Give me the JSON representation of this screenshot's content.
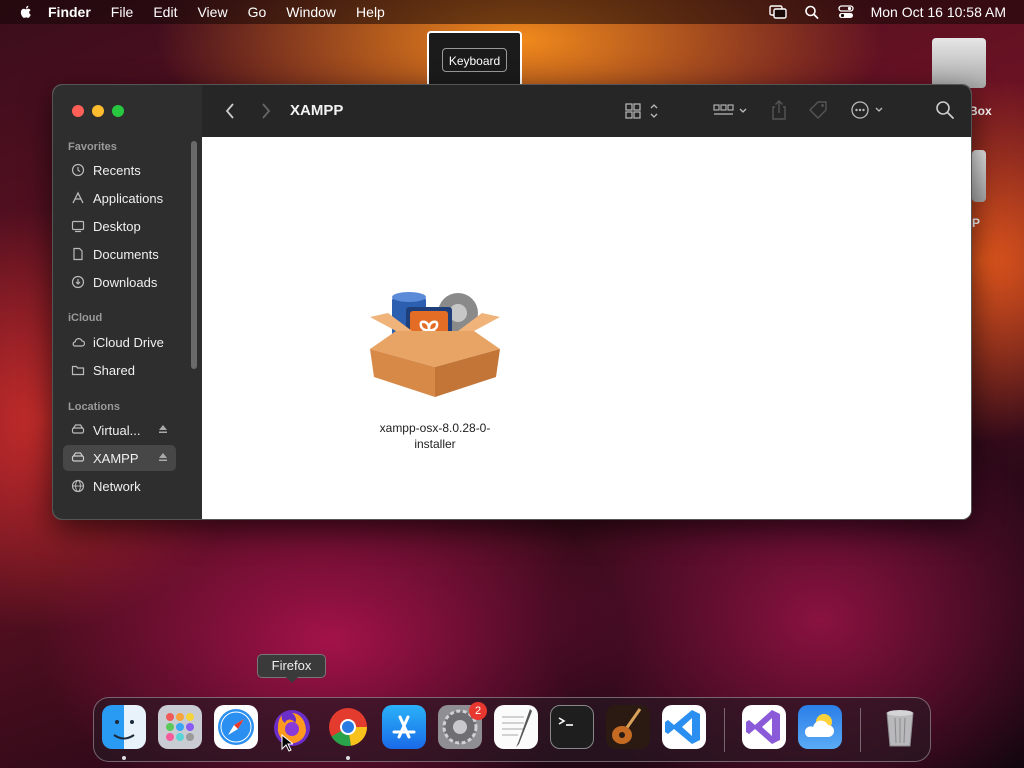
{
  "menubar": {
    "app": "Finder",
    "items": [
      "File",
      "Edit",
      "View",
      "Go",
      "Window",
      "Help"
    ],
    "clock": "Mon Oct 16  10:58 AM"
  },
  "keyboard_tooltip": "Keyboard",
  "desktop": {
    "items": [
      {
        "label": "Box"
      },
      {
        "label": "P"
      }
    ]
  },
  "finder": {
    "title": "XAMPP",
    "sidebar": {
      "favorites_label": "Favorites",
      "favorites": [
        "Recents",
        "Applications",
        "Desktop",
        "Documents",
        "Downloads"
      ],
      "icloud_label": "iCloud",
      "icloud": [
        "iCloud Drive",
        "Shared"
      ],
      "locations_label": "Locations",
      "locations": [
        "Virtual...",
        "XAMPP",
        "Network"
      ],
      "selected": "XAMPP"
    },
    "file": {
      "name_line1": "xampp-osx-8.0.28-0-",
      "name_line2": "installer"
    }
  },
  "dock": {
    "tooltip": "Firefox",
    "settings_badge": "2",
    "apps": [
      "Finder",
      "Launchpad",
      "Safari",
      "Firefox",
      "Chrome",
      "App Store",
      "System Settings",
      "TextEdit",
      "Terminal",
      "GarageBand",
      "Visual Studio Code",
      "Visual Studio",
      "Weather",
      "Trash"
    ]
  },
  "colors": {
    "close": "#ff5f57",
    "minimize": "#febc2e",
    "zoom": "#28c840",
    "sidebar_bg": "#2e2e2e",
    "toolbar_bg": "#262626"
  }
}
